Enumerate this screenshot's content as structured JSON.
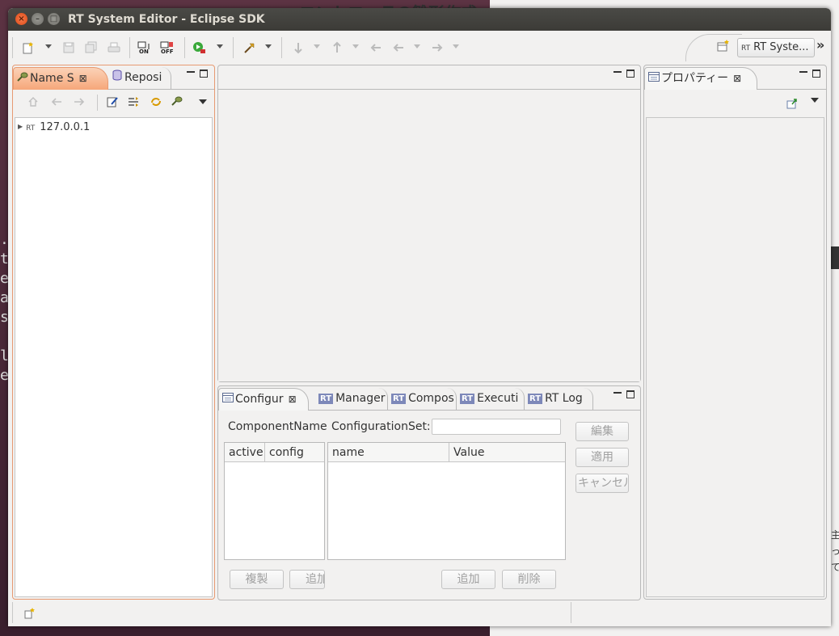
{
  "background": {
    "jp_title": "コントローラの雛形作成",
    "left_chars": [
      ".",
      "t",
      "e",
      "a",
      "s",
      "",
      "l",
      "e"
    ],
    "right_jp": [
      "主",
      "って"
    ]
  },
  "window": {
    "title": "RT System Editor - Eclipse SDK",
    "close_glyph": "×",
    "minimize_glyph": "–",
    "maximize_glyph": "□"
  },
  "toolbar": {
    "perspective_label": "RT Syste...",
    "perspective_badge": "RT",
    "more_glyph": "»"
  },
  "name_service": {
    "tabs": [
      {
        "label": "Name S",
        "icon": "plug-icon",
        "active": true
      },
      {
        "label": "Reposi",
        "icon": "repository-icon",
        "active": false
      }
    ],
    "close_glyph": "⊠",
    "tree": [
      {
        "label": "127.0.0.1",
        "badge": "RT",
        "expanded": false
      }
    ]
  },
  "bottom": {
    "tabs": [
      {
        "label": "Configur",
        "icon": "configuration-icon",
        "active": true
      },
      {
        "label": "Manager",
        "badge": "RT",
        "active": false
      },
      {
        "label": "Compos",
        "badge": "RT",
        "active": false
      },
      {
        "label": "Executi",
        "badge": "RT",
        "active": false
      },
      {
        "label": "RT Log",
        "badge": "RT",
        "active": false
      }
    ],
    "close_glyph": "⊠",
    "component_name_label": "ComponentName",
    "configuration_set_label": "ConfigurationSet:",
    "configuration_set_value": "",
    "left_grid_columns": [
      "active",
      "config"
    ],
    "right_grid_columns": [
      "name",
      "Value"
    ],
    "buttons": {
      "edit": "編集",
      "apply": "適用",
      "cancel": "キャンセル",
      "copy": "複製",
      "add_left": "追加",
      "add_right": "追加",
      "delete": "削除"
    }
  },
  "properties": {
    "tab_label": "プロパティー",
    "close_glyph": "⊠"
  }
}
